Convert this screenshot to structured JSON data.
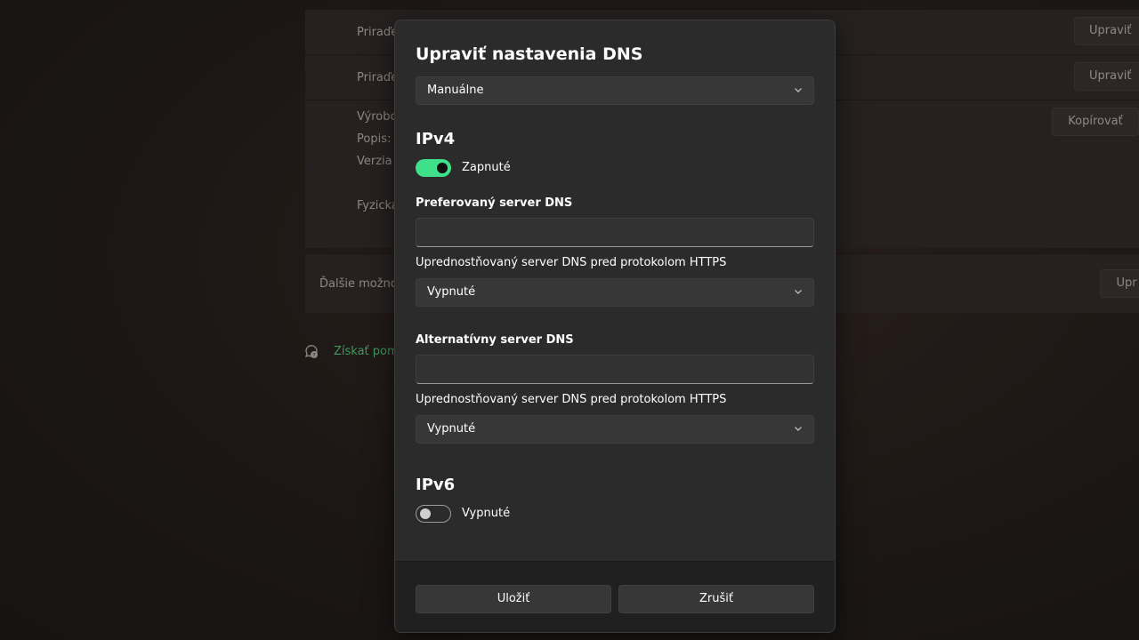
{
  "background": {
    "rows": [
      {
        "label": "Priraďe",
        "button": "Upraviť"
      },
      {
        "label": "Priraďe",
        "button": "Upraviť"
      }
    ],
    "properties": {
      "labels": [
        "Výrobc",
        "Popis:",
        "Verzia",
        "Fyzická"
      ],
      "button": "Kopírovať"
    },
    "more_options": {
      "label": "Ďalšie možno",
      "button": "Upr"
    },
    "help_link": "Získať pom"
  },
  "dialog": {
    "title": "Upraviť nastavenia DNS",
    "mode_select": {
      "value": "Manuálne"
    },
    "ipv4": {
      "heading": "IPv4",
      "toggle_on": true,
      "toggle_label": "Zapnuté",
      "preferred_label": "Preferovaný server DNS",
      "preferred_value": "",
      "preferred_https_label": "Uprednostňovaný server DNS pred protokolom HTTPS",
      "preferred_https_value": "Vypnuté",
      "alternate_label": "Alternatívny server DNS",
      "alternate_value": "",
      "alternate_https_label": "Uprednostňovaný server DNS pred protokolom HTTPS",
      "alternate_https_value": "Vypnuté"
    },
    "ipv6": {
      "heading": "IPv6",
      "toggle_on": false,
      "toggle_label": "Vypnuté"
    },
    "buttons": {
      "save": "Uložiť",
      "cancel": "Zrušiť"
    }
  },
  "colors": {
    "accent": "#3ee08a",
    "link": "#3f9a5d",
    "dialog_bg": "#2b2b2b",
    "footer_bg": "#202020"
  }
}
